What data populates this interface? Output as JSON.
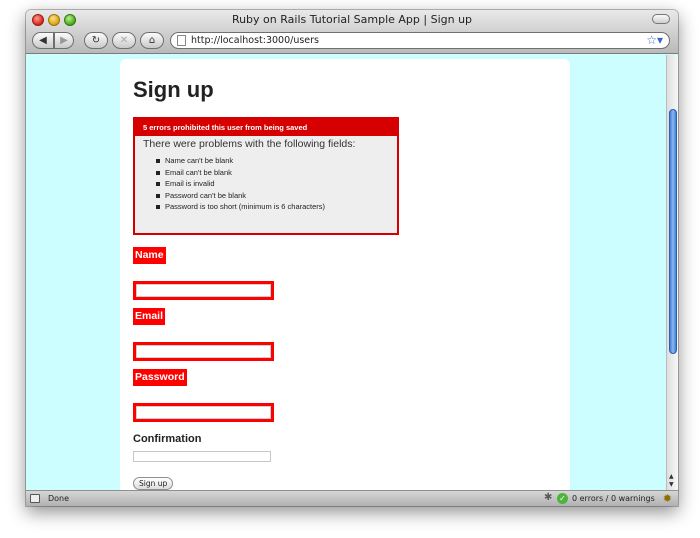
{
  "window": {
    "title": "Ruby on Rails Tutorial Sample App | Sign up"
  },
  "toolbar": {
    "back_glyph": "◀",
    "forward_glyph": "▶",
    "reload_glyph": "↻",
    "stop_glyph": "✕",
    "home_glyph": "⌂",
    "url": "http://localhost:3000/users",
    "bookmark_glyph": "☆▾"
  },
  "page": {
    "title": "Sign up",
    "error_box": {
      "header": "5 errors prohibited this user from being saved",
      "subheading": "There were problems with the following fields:",
      "messages": [
        "Name can't be blank",
        "Email can't be blank",
        "Email is invalid",
        "Password can't be blank",
        "Password is too short (minimum is 6 characters)"
      ]
    },
    "form": {
      "name_label": "Name",
      "email_label": "Email",
      "password_label": "Password",
      "confirmation_label": "Confirmation",
      "name_value": "",
      "email_value": "",
      "password_value": "",
      "confirmation_value": "",
      "submit_label": "Sign up"
    }
  },
  "status": {
    "left_text": "Done",
    "validator_text": "0 errors / 0 warnings",
    "check_glyph": "✓",
    "puzzle_glyph": "✱",
    "bug_glyph": "✹"
  },
  "colors": {
    "page_background": "#ccfeff",
    "error_red": "#ff0000",
    "error_header_red": "#d60000"
  },
  "icons": {
    "page": "document-icon",
    "bookmark": "star-icon",
    "validator": "check-icon",
    "addon": "puzzle-icon",
    "firebug": "bug-icon"
  }
}
